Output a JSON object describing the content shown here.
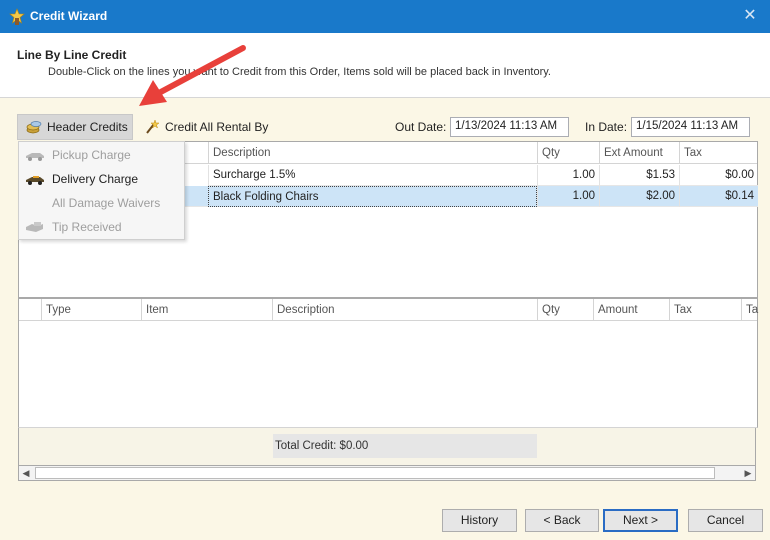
{
  "window": {
    "title": "Credit Wizard"
  },
  "header": {
    "title": "Line By Line Credit",
    "subtitle": "Double-Click on the lines you want to Credit from this Order, Items sold will be placed back in Inventory."
  },
  "toolbar": {
    "header_credits": "Header Credits",
    "credit_all_rental": "Credit All Rental By",
    "out_date_label": "Out Date:",
    "out_date_value": "1/13/2024 11:13 AM",
    "in_date_label": "In Date:",
    "in_date_value": "1/15/2024 11:13 AM"
  },
  "header_menu": {
    "items": [
      {
        "label": "Pickup Charge",
        "enabled": false,
        "icon": "truck-icon"
      },
      {
        "label": "Delivery Charge",
        "enabled": true,
        "icon": "truck-icon"
      },
      {
        "label": "All Damage Waivers",
        "enabled": false,
        "icon": ""
      },
      {
        "label": "Tip Received",
        "enabled": false,
        "icon": "hand-money-icon"
      }
    ]
  },
  "order_grid": {
    "columns": [
      "Description",
      "Qty",
      "Ext Amount",
      "Tax"
    ],
    "rows": [
      {
        "description": "Surcharge 1.5%",
        "qty": "1.00",
        "ext_amount": "$1.53",
        "tax": "$0.00"
      },
      {
        "description": "Black Folding Chairs",
        "qty": "1.00",
        "ext_amount": "$2.00",
        "tax": "$0.14"
      }
    ]
  },
  "credit_grid": {
    "columns": [
      "Type",
      "Item",
      "Description",
      "Qty",
      "Amount",
      "Tax",
      "Ta"
    ]
  },
  "totals": {
    "total_credit": "Total Credit:  $0.00"
  },
  "footer": {
    "history": "History",
    "back": "< Back",
    "next": "Next >",
    "cancel": "Cancel"
  },
  "colors": {
    "titlebar": "#1979ca",
    "selection": "#cde4f7",
    "panel": "#fbf7e6",
    "annotation_arrow": "#e8403a"
  }
}
